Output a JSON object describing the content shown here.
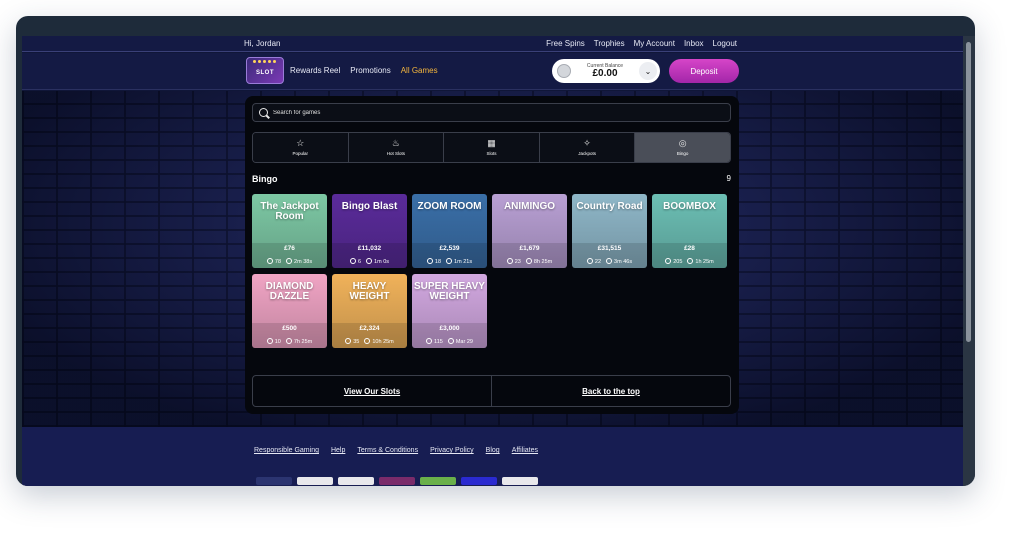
{
  "topbar": {
    "greeting": "Hi, Jordan",
    "links": [
      "Free Spins",
      "Trophies",
      "My Account",
      "Inbox",
      "Logout"
    ]
  },
  "header": {
    "logo_text": "SLOT",
    "nav": [
      "Rewards Reel",
      "Promotions",
      "All Games"
    ],
    "balance_label": "Current Balance",
    "balance_value": "£0.00",
    "deposit_label": "Deposit"
  },
  "search": {
    "placeholder": "Search for games"
  },
  "categories": [
    {
      "label": "Popular",
      "icon": "star-icon",
      "glyph": "☆"
    },
    {
      "label": "Hot Slots",
      "icon": "flame-icon",
      "glyph": "♨"
    },
    {
      "label": "Slots",
      "icon": "slot-machine-icon",
      "glyph": "▦"
    },
    {
      "label": "Jackpots",
      "icon": "jackpot-icon",
      "glyph": "✧"
    },
    {
      "label": "Bingo",
      "icon": "bingo-ball-icon",
      "glyph": "◎"
    }
  ],
  "section": {
    "title": "Bingo",
    "count": "9"
  },
  "games": [
    {
      "name": "The Jackpot Room",
      "prize": "£76",
      "players": "78",
      "time": "2m 38s",
      "color": "#7dc8a4"
    },
    {
      "name": "Bingo Blast",
      "prize": "£11,032",
      "players": "6",
      "time": "1m 0s",
      "color": "#5a2b9a"
    },
    {
      "name": "ZOOM ROOM",
      "prize": "£2,539",
      "players": "18",
      "time": "1m 21s",
      "color": "#3a6fa8"
    },
    {
      "name": "ANIMINGO",
      "prize": "£1,679",
      "players": "23",
      "time": "8h 25m",
      "color": "#b9a0d4"
    },
    {
      "name": "Country Road",
      "prize": "£31,515",
      "players": "22",
      "time": "3m 46s",
      "color": "#8fb7c8"
    },
    {
      "name": "BOOMBOX",
      "prize": "£28",
      "players": "205",
      "time": "1h 25m",
      "color": "#6cbfb4"
    },
    {
      "name": "DIAMOND DAZZLE",
      "prize": "£500",
      "players": "10",
      "time": "7h 25m",
      "color": "#f0a4c4"
    },
    {
      "name": "HEAVY WEIGHT",
      "prize": "£2,324",
      "players": "35",
      "time": "10h 25m",
      "color": "#f0b25a"
    },
    {
      "name": "SUPER HEAVY WEIGHT",
      "prize": "£3,000",
      "players": "115",
      "time": "Mar 29",
      "color": "#d2a8e0"
    }
  ],
  "panel_footer": {
    "left": "View Our Slots",
    "right": "Back to the top"
  },
  "footer": {
    "links": [
      "Responsible Gaming",
      "Help",
      "Terms & Conditions",
      "Privacy Policy",
      "Blog",
      "Affiliates"
    ],
    "badge_colors": [
      "#2b3470",
      "#e8e8ec",
      "#e8e8ec",
      "#7a2b6a",
      "#6ab04a",
      "#2a2ad0",
      "#e8e8ec"
    ]
  },
  "colors": {
    "accent": "#f5b63c",
    "deposit": "#c23cbc",
    "panel": "#05070d"
  }
}
